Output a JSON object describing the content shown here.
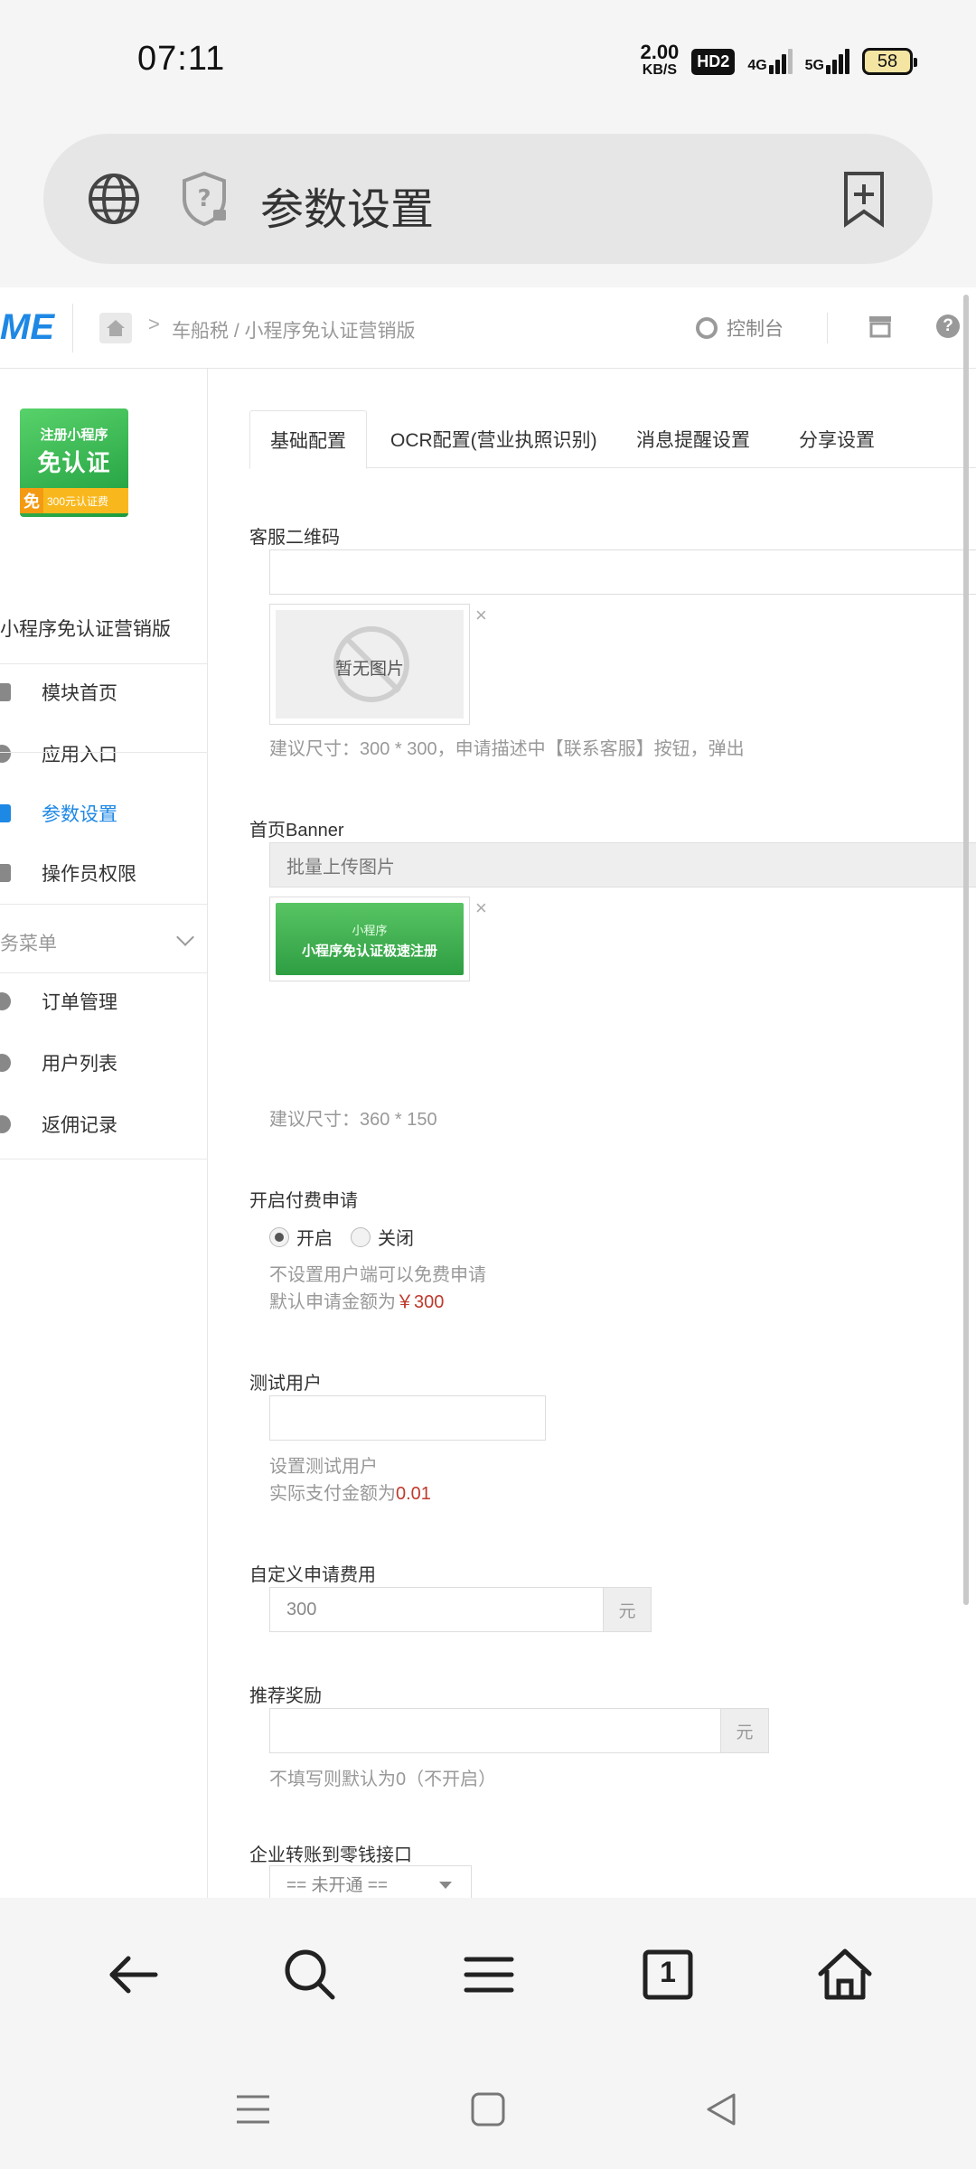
{
  "status_bar": {
    "time": "07:11",
    "speed_value": "2.00",
    "speed_unit": "KB/S",
    "hd_label": "HD2",
    "net1": "4G",
    "net2": "5G",
    "battery": "58"
  },
  "address_bar": {
    "title": "参数设置"
  },
  "top_nav": {
    "logo": "ME",
    "breadcrumb": "车船税 / 小程序免认证营销版",
    "breadcrumb_sep": ">",
    "console_label": "控制台",
    "help": "?"
  },
  "sidebar": {
    "module_logo": {
      "line1": "注册小程序",
      "line2": "免认证",
      "badge_char": "免",
      "badge_text": "300元认证费"
    },
    "module_name": "小程序免认证营销版",
    "items": [
      {
        "label": "模块首页"
      },
      {
        "label": "应用入口"
      },
      {
        "label": "参数设置"
      },
      {
        "label": "操作员权限"
      }
    ],
    "group_label": "务菜单",
    "group_items": [
      {
        "label": "订单管理"
      },
      {
        "label": "用户列表"
      },
      {
        "label": "返佣记录"
      }
    ]
  },
  "tabs": [
    {
      "label": "基础配置"
    },
    {
      "label": "OCR配置(营业执照识别)"
    },
    {
      "label": "消息提醒设置"
    },
    {
      "label": "分享设置"
    }
  ],
  "form": {
    "service_qr": {
      "label": "客服二维码",
      "no_image": "暂无图片",
      "remove": "×",
      "hint": "建议尺寸：300 * 300，申请描述中【联系客服】按钮，弹出"
    },
    "banner": {
      "label": "首页Banner",
      "upload_placeholder": "批量上传图片",
      "banner_line1": "小程序",
      "banner_line2": "小程序免认证极速注册",
      "remove": "×",
      "hint": "建议尺寸：360 * 150"
    },
    "paid_apply": {
      "label": "开启付费申请",
      "option_on": "开启",
      "option_off": "关闭",
      "selected": "开启",
      "hint1": "不设置用户端可以免费申请",
      "hint2_prefix": "默认申请金额为",
      "hint2_amount": "￥300"
    },
    "test_user": {
      "label": "测试用户",
      "value": "",
      "hint1": "设置测试用户",
      "hint2_prefix": "实际支付金额为",
      "hint2_amount": "0.01"
    },
    "custom_fee": {
      "label": "自定义申请费用",
      "placeholder": "300",
      "unit": "元"
    },
    "referral": {
      "label": "推荐奖励",
      "value": "",
      "unit": "元",
      "hint": "不填写则默认为0（不开启）"
    },
    "transfer": {
      "label": "企业转账到零钱接口",
      "selected": "== 未开通 =="
    }
  },
  "browser_bar": {
    "tab_count": "1"
  },
  "colors": {
    "accent": "#1e88e5",
    "price_red": "#c0392b"
  }
}
